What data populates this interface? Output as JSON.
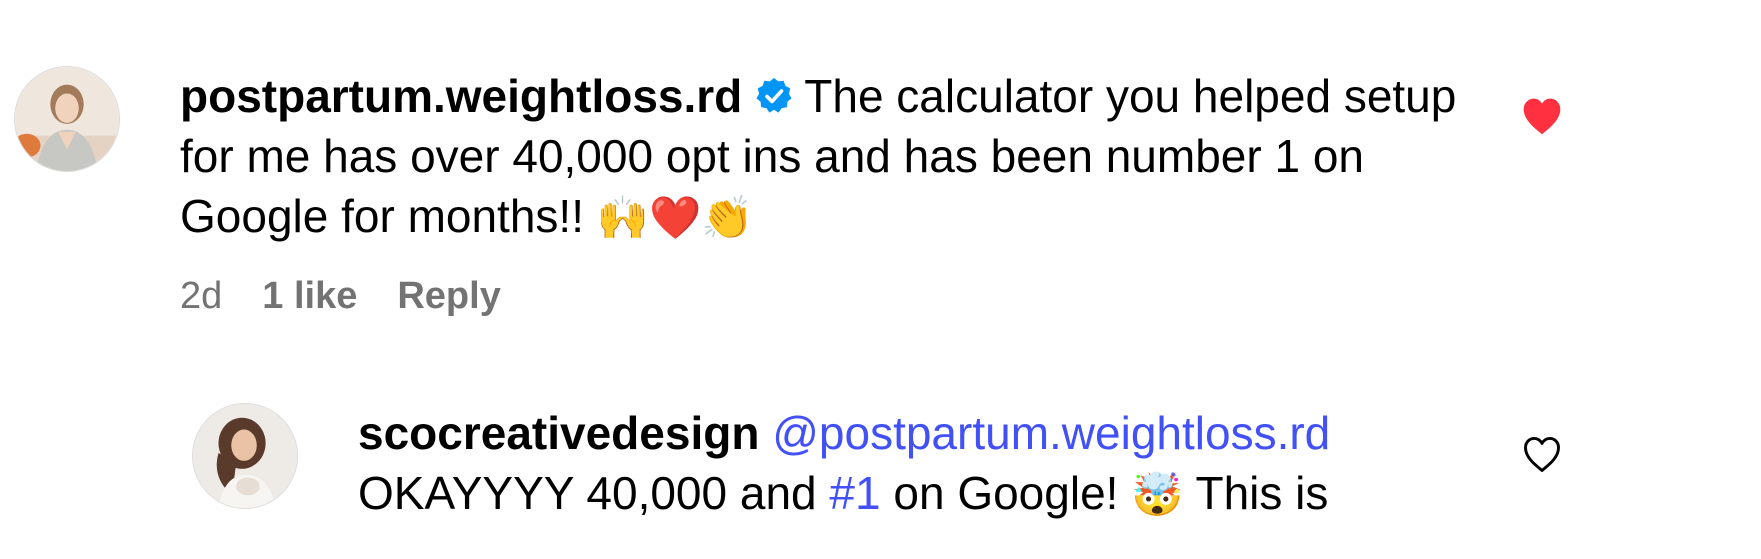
{
  "comments": [
    {
      "username": "postpartum.weightloss.rd",
      "verified": true,
      "text": "The calculator you helped setup for me has over 40,000 opt ins and has been number 1 on Google for months!!",
      "emojis": "🙌❤️👏",
      "time": "2d",
      "likes": "1 like",
      "reply_label": "Reply",
      "liked": true
    },
    {
      "username": "scocreativedesign",
      "mention": "@postpartum.weightloss.rd",
      "text_before_hashtag": "OKAYYYY 40,000 and",
      "hashtag": "#1",
      "text_after_hashtag": "on Google!",
      "emoji": "🤯",
      "text_end": "This is",
      "liked": false
    }
  ],
  "colors": {
    "like_active": "#ff3040",
    "link": "#4150f7",
    "meta_text": "#737373",
    "verified": "#0095f6"
  },
  "icons": [
    "verified-badge-icon",
    "heart-filled-icon",
    "heart-outline-icon"
  ]
}
